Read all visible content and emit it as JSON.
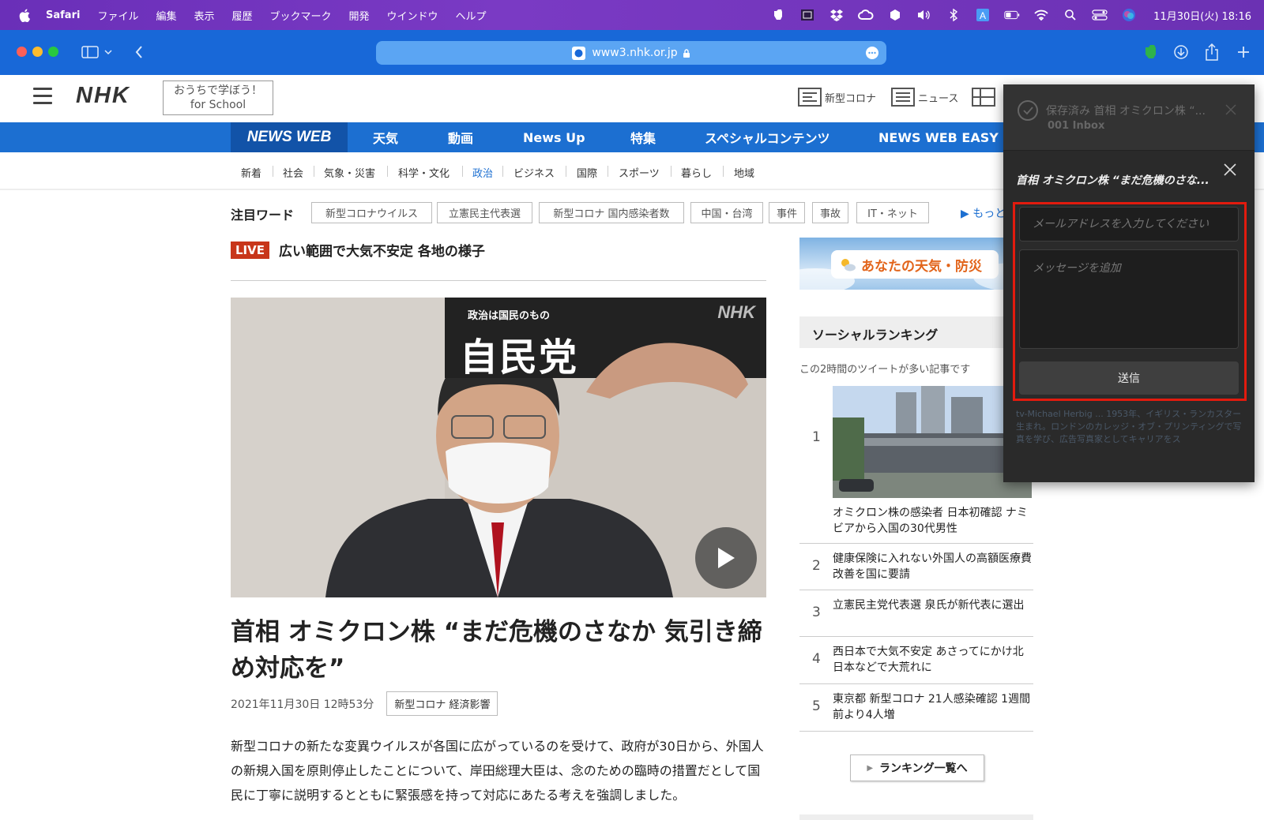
{
  "menubar": {
    "app": "Safari",
    "items": [
      "ファイル",
      "編集",
      "表示",
      "履歴",
      "ブックマーク",
      "開発",
      "ウインドウ",
      "ヘルプ"
    ],
    "clock": "11月30日(火) 18:16",
    "icons": [
      "evernote-icon",
      "calendar-icon",
      "dropbox-icon",
      "creative-cloud-icon",
      "app-icon",
      "volume-icon",
      "bluetooth-icon",
      "input-source-icon",
      "battery-icon",
      "wifi-icon",
      "spotlight-icon",
      "control-center-icon",
      "siri-icon"
    ]
  },
  "browser": {
    "url": "www3.nhk.or.jp",
    "colors": {
      "toolbar": "#1868d8",
      "urlbar": "#5ba5f3"
    }
  },
  "site": {
    "logo": "NHK",
    "for_school_line1": "おうちで学ぼう！",
    "for_school_line2": "for School",
    "header_links": [
      "新型コロナ",
      "ニュース"
    ],
    "newsweb_label": "NEWS WEB",
    "nav": [
      "天気",
      "動画",
      "News Up",
      "特集",
      "スペシャルコンテンツ",
      "NEWS WEB EASY"
    ],
    "subnav": [
      "新着",
      "社会",
      "気象・災害",
      "科学・文化",
      "政治",
      "ビジネス",
      "国際",
      "スポーツ",
      "暮らし",
      "地域"
    ],
    "subnav_active": "政治"
  },
  "keywords": {
    "label": "注目ワード",
    "items": [
      "新型コロナウイルス",
      "立憲民主代表選",
      "新型コロナ 国内感染者数",
      "中国・台湾",
      "事件",
      "事故",
      "IT・ネット"
    ],
    "more": "もっと"
  },
  "live": {
    "badge": "LIVE",
    "title": "広い範囲で大気不安定 各地の様子"
  },
  "video": {
    "banner_small": "政治は国民のもの",
    "banner_big": "自民党",
    "watermark": "NHK"
  },
  "article": {
    "headline": "首相 オミクロン株 “まだ危機のさなか 気引き締め対応を”",
    "date": "2021年11月30日 12時53分",
    "tag": "新型コロナ 経済影響",
    "body": "新型コロナの新たな変異ウイルスが各国に広がっているのを受けて、政府が30日から、外国人の新規入国を原則停止したことについて、岸田総理大臣は、念のための臨時の措置だとして国民に丁寧に説明するとともに緊張感を持って対応にあたる考えを強調しました。"
  },
  "sidebar": {
    "weather": "あなたの天気・防災",
    "social_title": "ソーシャルランキング",
    "social_sub": "この2時間のツイートが多い記事です",
    "ranking": [
      {
        "num": "1",
        "text": "オミクロン株の感染者 日本初確認 ナミビアから入国の30代男性"
      },
      {
        "num": "2",
        "text": "健康保険に入れない外国人の高額医療費 改善を国に要請"
      },
      {
        "num": "3",
        "text": "立憲民主党代表選 泉氏が新代表に選出"
      },
      {
        "num": "4",
        "text": "西日本で大気不安定 あさってにかけ北日本などで大荒れに"
      },
      {
        "num": "5",
        "text": "東京都 新型コロナ 21人感染確認 1週間前より4人増"
      }
    ],
    "ranking_button": "ランキング一覧へ"
  },
  "popup": {
    "saved": "保存済み 首相 オミクロン株 “...",
    "inbox": "001 Inbox",
    "title": "首相 オミクロン株 “まだ危機のさな...",
    "email_placeholder": "メールアドレスを入力してください",
    "message_placeholder": "メッセージを追加",
    "send": "送信",
    "ghost": "tv-Michael Herbig ... 1953年、イギリス・ランカスター生まれ。ロンドンのカレッジ・オブ・プリンティングで写真を学び、広告写真家としてキャリアをス",
    "highlight_color": "#e21b0e"
  }
}
